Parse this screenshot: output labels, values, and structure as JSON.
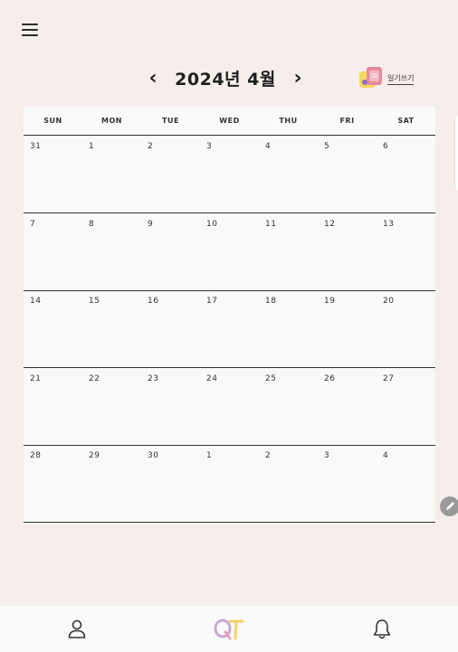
{
  "header": {
    "title": "2024년 4월",
    "prev": "‹",
    "next": "›",
    "diary_label": "일기쓰기"
  },
  "weekdays": [
    "SUN",
    "MON",
    "TUE",
    "WED",
    "THU",
    "FRI",
    "SAT"
  ],
  "weeks": [
    [
      "31",
      "1",
      "2",
      "3",
      "4",
      "5",
      "6"
    ],
    [
      "7",
      "8",
      "9",
      "10",
      "11",
      "12",
      "13"
    ],
    [
      "14",
      "15",
      "16",
      "17",
      "18",
      "19",
      "20"
    ],
    [
      "21",
      "22",
      "23",
      "24",
      "25",
      "26",
      "27"
    ],
    [
      "28",
      "29",
      "30",
      "1",
      "2",
      "3",
      "4"
    ]
  ],
  "icons": {
    "menu": "menu-icon",
    "diary": "diary-icon",
    "edit": "pencil-icon",
    "profile": "profile-icon",
    "home": "qt-logo-icon",
    "notifications": "bell-icon"
  },
  "colors": {
    "background": "#f6eeec",
    "calendar_bg": "#faf8f9",
    "line": "#333333"
  }
}
